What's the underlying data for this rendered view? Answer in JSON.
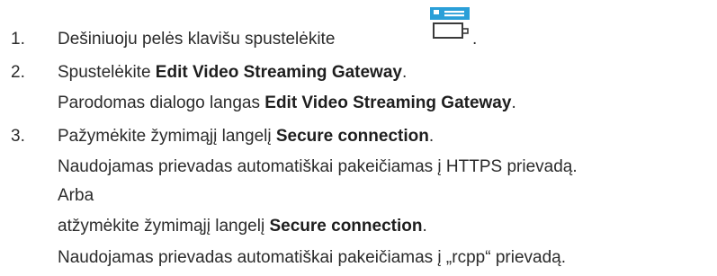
{
  "steps": [
    {
      "number": "1.",
      "text": "Dešiniuoju pelės klavišu spustelėkite",
      "trailing": "."
    },
    {
      "number": "2.",
      "text_before": "Spustelėkite ",
      "bold": "Edit Video Streaming Gateway",
      "text_after": ".",
      "result_before": "Parodomas dialogo langas ",
      "result_bold": "Edit Video Streaming Gateway",
      "result_after": "."
    },
    {
      "number": "3.",
      "text_before": "Pažymėkite žymimąjį langelį ",
      "bold": "Secure connection",
      "text_after": ".",
      "result": "Naudojamas prievadas automatiškai pakeičiamas į HTTPS prievadą.",
      "or": "Arba",
      "alt_before": "atžymėkite žymimąjį langelį ",
      "alt_bold": "Secure connection",
      "alt_after": ".",
      "alt_result": "Naudojamas prievadas automatiškai pakeičiamas į „rcpp“ prievadą."
    }
  ],
  "icon": {
    "name": "video-streaming-gateway-icon",
    "accent": "#2a9fd8",
    "frame": "#3a3a3a"
  }
}
